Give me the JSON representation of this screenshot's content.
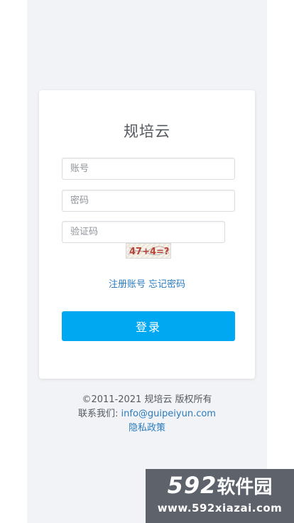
{
  "card": {
    "title": "规培云",
    "account_placeholder": "账号",
    "password_placeholder": "密码",
    "captcha_placeholder": "验证码",
    "captcha_text": "47+4=?",
    "register_link": "注册账号",
    "forgot_link": "忘记密码",
    "login_button": "登录"
  },
  "footer": {
    "copyright": "©2011-2021 规培云 版权所有",
    "contact_label": "联系我们:",
    "contact_email": "info@guipeiyun.com",
    "privacy": "隐私政策"
  },
  "watermark": {
    "number": "592",
    "name": "软件园",
    "url": "www.592xiazai.com"
  },
  "colors": {
    "accent": "#00a8f2",
    "link": "#2b7bbf",
    "background_column": "#f1f3f6"
  }
}
